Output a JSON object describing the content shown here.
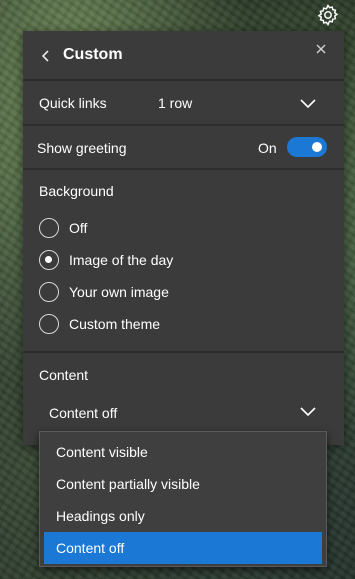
{
  "settings_icon": "gear-icon",
  "panel": {
    "title": "Custom",
    "back_icon": "chevron-left-icon",
    "close_icon": "close-icon"
  },
  "quick_links": {
    "label": "Quick links",
    "value": "1 row"
  },
  "show_greeting": {
    "label": "Show greeting",
    "state_text": "On",
    "enabled": true
  },
  "background": {
    "label": "Background",
    "options": [
      {
        "label": "Off",
        "checked": false
      },
      {
        "label": "Image of the day",
        "checked": true
      },
      {
        "label": "Your own image",
        "checked": false
      },
      {
        "label": "Custom theme",
        "checked": false
      }
    ]
  },
  "content": {
    "label": "Content",
    "selected": "Content off",
    "options": [
      {
        "label": "Content visible",
        "selected": false
      },
      {
        "label": "Content partially visible",
        "selected": false
      },
      {
        "label": "Headings only",
        "selected": false
      },
      {
        "label": "Content off",
        "selected": true
      }
    ]
  },
  "colors": {
    "accent": "#1b78d4",
    "panel_bg": "#3b3b3b",
    "dropdown_bg": "#3f3f3f"
  }
}
